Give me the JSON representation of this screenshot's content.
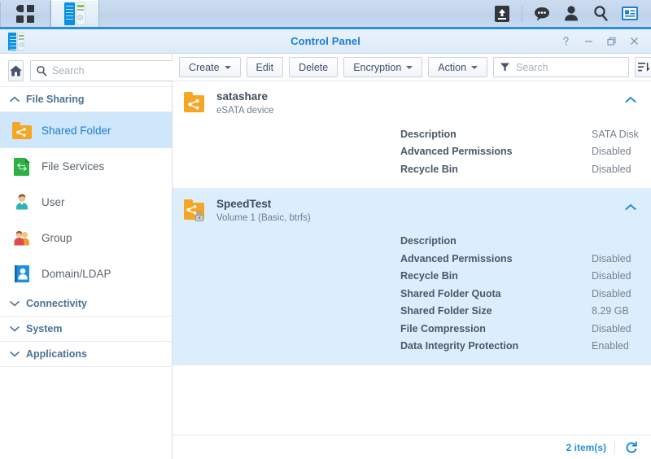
{
  "taskbar": {
    "apps": [
      {
        "name": "app-menu",
        "icon": "grid-icon",
        "active": false
      },
      {
        "name": "control-panel-task",
        "icon": "control-panel-icon",
        "active": true
      }
    ],
    "tray": [
      {
        "name": "upload-queue-icon",
        "label": "Upload Queue"
      },
      {
        "name": "notifications-icon",
        "label": "Notifications"
      },
      {
        "name": "user-account-icon",
        "label": "Account"
      },
      {
        "name": "search-icon",
        "label": "Search"
      },
      {
        "name": "widgets-icon",
        "label": "Widgets"
      }
    ]
  },
  "window": {
    "title": "Control Panel",
    "controls": {
      "help": "?",
      "minimize": "–",
      "maximize": "❐",
      "close": "✕"
    }
  },
  "sidebar": {
    "home_label": "Home",
    "search": {
      "placeholder": "Search",
      "value": ""
    },
    "groups": [
      {
        "label": "File Sharing",
        "expanded": true,
        "chevron": "chevron-up-icon",
        "items": [
          {
            "label": "Shared Folder",
            "icon": "shared-folder-icon",
            "selected": true
          },
          {
            "label": "File Services",
            "icon": "file-services-icon",
            "selected": false
          },
          {
            "label": "User",
            "icon": "user-icon",
            "selected": false
          },
          {
            "label": "Group",
            "icon": "group-icon",
            "selected": false
          },
          {
            "label": "Domain/LDAP",
            "icon": "domain-ldap-icon",
            "selected": false
          }
        ]
      },
      {
        "label": "Connectivity",
        "expanded": false,
        "chevron": "chevron-down-icon",
        "items": []
      },
      {
        "label": "System",
        "expanded": false,
        "chevron": "chevron-down-icon",
        "items": []
      },
      {
        "label": "Applications",
        "expanded": false,
        "chevron": "chevron-down-icon",
        "items": []
      }
    ]
  },
  "toolbar": {
    "create_label": "Create",
    "edit_label": "Edit",
    "delete_label": "Delete",
    "encryption_label": "Encryption",
    "action_label": "Action",
    "search": {
      "placeholder": "Search",
      "value": ""
    },
    "list_options_label": "List Options"
  },
  "folders": [
    {
      "name": "satashare",
      "subtitle": "eSATA device",
      "icon": "shared-folder-icon",
      "encrypted": false,
      "selected": false,
      "collapse_icon": "chevron-up-icon",
      "properties": [
        {
          "label": "Description",
          "value": "SATA Disk"
        },
        {
          "label": "Advanced Permissions",
          "value": "Disabled"
        },
        {
          "label": "Recycle Bin",
          "value": "Disabled"
        }
      ]
    },
    {
      "name": "SpeedTest",
      "subtitle": "Volume 1 (Basic, btrfs)",
      "icon": "shared-folder-encrypted-icon",
      "encrypted": true,
      "selected": true,
      "collapse_icon": "chevron-up-icon",
      "properties": [
        {
          "label": "Description",
          "value": ""
        },
        {
          "label": "Advanced Permissions",
          "value": "Disabled"
        },
        {
          "label": "Recycle Bin",
          "value": "Disabled"
        },
        {
          "label": "Shared Folder Quota",
          "value": "Disabled"
        },
        {
          "label": "Shared Folder Size",
          "value": "8.29 GB"
        },
        {
          "label": "File Compression",
          "value": "Disabled"
        },
        {
          "label": "Data Integrity Protection",
          "value": "Enabled"
        }
      ]
    }
  ],
  "footer": {
    "count_label": "2 item(s)",
    "refresh_label": "Refresh"
  },
  "colors": {
    "accent": "#2b8fe0",
    "title": "#1a7fd4",
    "selection": "#cfe7fa",
    "row_selection": "#dcedfb",
    "folder_orange": "#f5a623",
    "green": "#2eb045"
  }
}
